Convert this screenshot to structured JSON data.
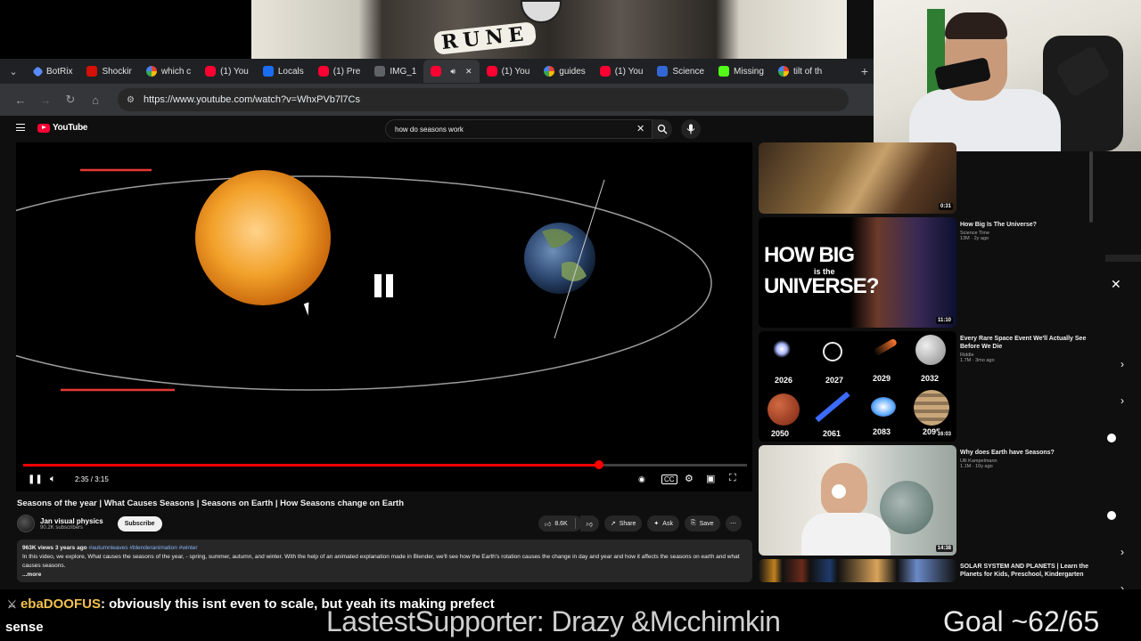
{
  "browser": {
    "tabs": [
      {
        "icon": "botrix",
        "label": "BotRix"
      },
      {
        "icon": "lastfm",
        "label": "Shockir"
      },
      {
        "icon": "google",
        "label": "which c"
      },
      {
        "icon": "youtube",
        "label": "(1) You"
      },
      {
        "icon": "locals",
        "label": "Locals"
      },
      {
        "icon": "youtube",
        "label": "(1) Pre"
      },
      {
        "icon": "image",
        "label": "IMG_1"
      },
      {
        "icon": "youtube",
        "label": ""
      },
      {
        "icon": "youtube",
        "label": "(1) You"
      },
      {
        "icon": "google",
        "label": "guides"
      },
      {
        "icon": "youtube",
        "label": "(1) You"
      },
      {
        "icon": "gif",
        "label": "Science"
      },
      {
        "icon": "k",
        "label": "Missing"
      },
      {
        "icon": "google",
        "label": "tilt of th"
      }
    ],
    "url": "https://www.youtube.com/watch?v=WhxPVb7l7Cs"
  },
  "overlay": {
    "banner_text": "RUNE"
  },
  "youtube": {
    "logo": "YouTube",
    "search_query": "how do seasons work",
    "player": {
      "time": "2:35 / 3:15",
      "progress": 0.795
    },
    "video": {
      "title": "Seasons of the year | What Causes Seasons | Seasons on Earth | How Seasons change on Earth",
      "channel": "Jan visual physics",
      "subscribers": "90.2K subscribers",
      "subscribe_label": "Subscribe",
      "likes": "8.6K",
      "share_label": "Share",
      "ask_label": "Ask",
      "save_label": "Save",
      "desc_meta": "963K views  3 years ago",
      "desc_tags": "#autumnleaves #blenderanimation #winter",
      "desc_text": "In this video, we explore, What causes the seasons of the year, - spring, summer, autumn, and winter. With the help of an animated explanation made in Blender, we'll see how the Earth's rotation causes the change in day and year and how it affects the seasons on earth and what causes seasons.",
      "more_label": "...more"
    },
    "sidebar": [
      {
        "title": "",
        "channel": "",
        "stats": "",
        "duration": "0:31"
      },
      {
        "title": "How Big Is The Universe?",
        "channel": "Science Time",
        "stats": "13M · 2y ago",
        "duration": "11:10",
        "thumb_text_1": "HOW BIG",
        "thumb_text_2": "is the",
        "thumb_text_3": "UNIVERSE?"
      },
      {
        "title": "Every Rare Space Event We'll Actually See Before We Die",
        "channel": "Riddle",
        "stats": "1.7M · 3mo ago",
        "duration": "16:03",
        "years": [
          "2026",
          "2027",
          "2029",
          "2032",
          "2050",
          "2061",
          "2083",
          "2095"
        ]
      },
      {
        "title": "Why does Earth have Seasons?",
        "channel": "Ulli Kampelmann",
        "stats": "1.1M · 10y ago",
        "duration": "14:38"
      },
      {
        "title": "SOLAR SYSTEM AND PLANETS | Learn the Planets for Kids, Preschool, Kindergarten",
        "channel": "",
        "stats": "",
        "duration": ""
      }
    ]
  },
  "stream": {
    "chat_user": "ebaDOOFUS",
    "chat_message": ": obviously this isnt even to scale, but yeah its making prefect",
    "chat_message_cont": "sense",
    "supporter": "LastestSupporter: Drazy &Mcchimkin",
    "goal": "Goal ~62/65"
  },
  "colors": {
    "accent": "#ff0000",
    "yt_red": "#ff0033",
    "chat_user": "#f2c14e"
  }
}
